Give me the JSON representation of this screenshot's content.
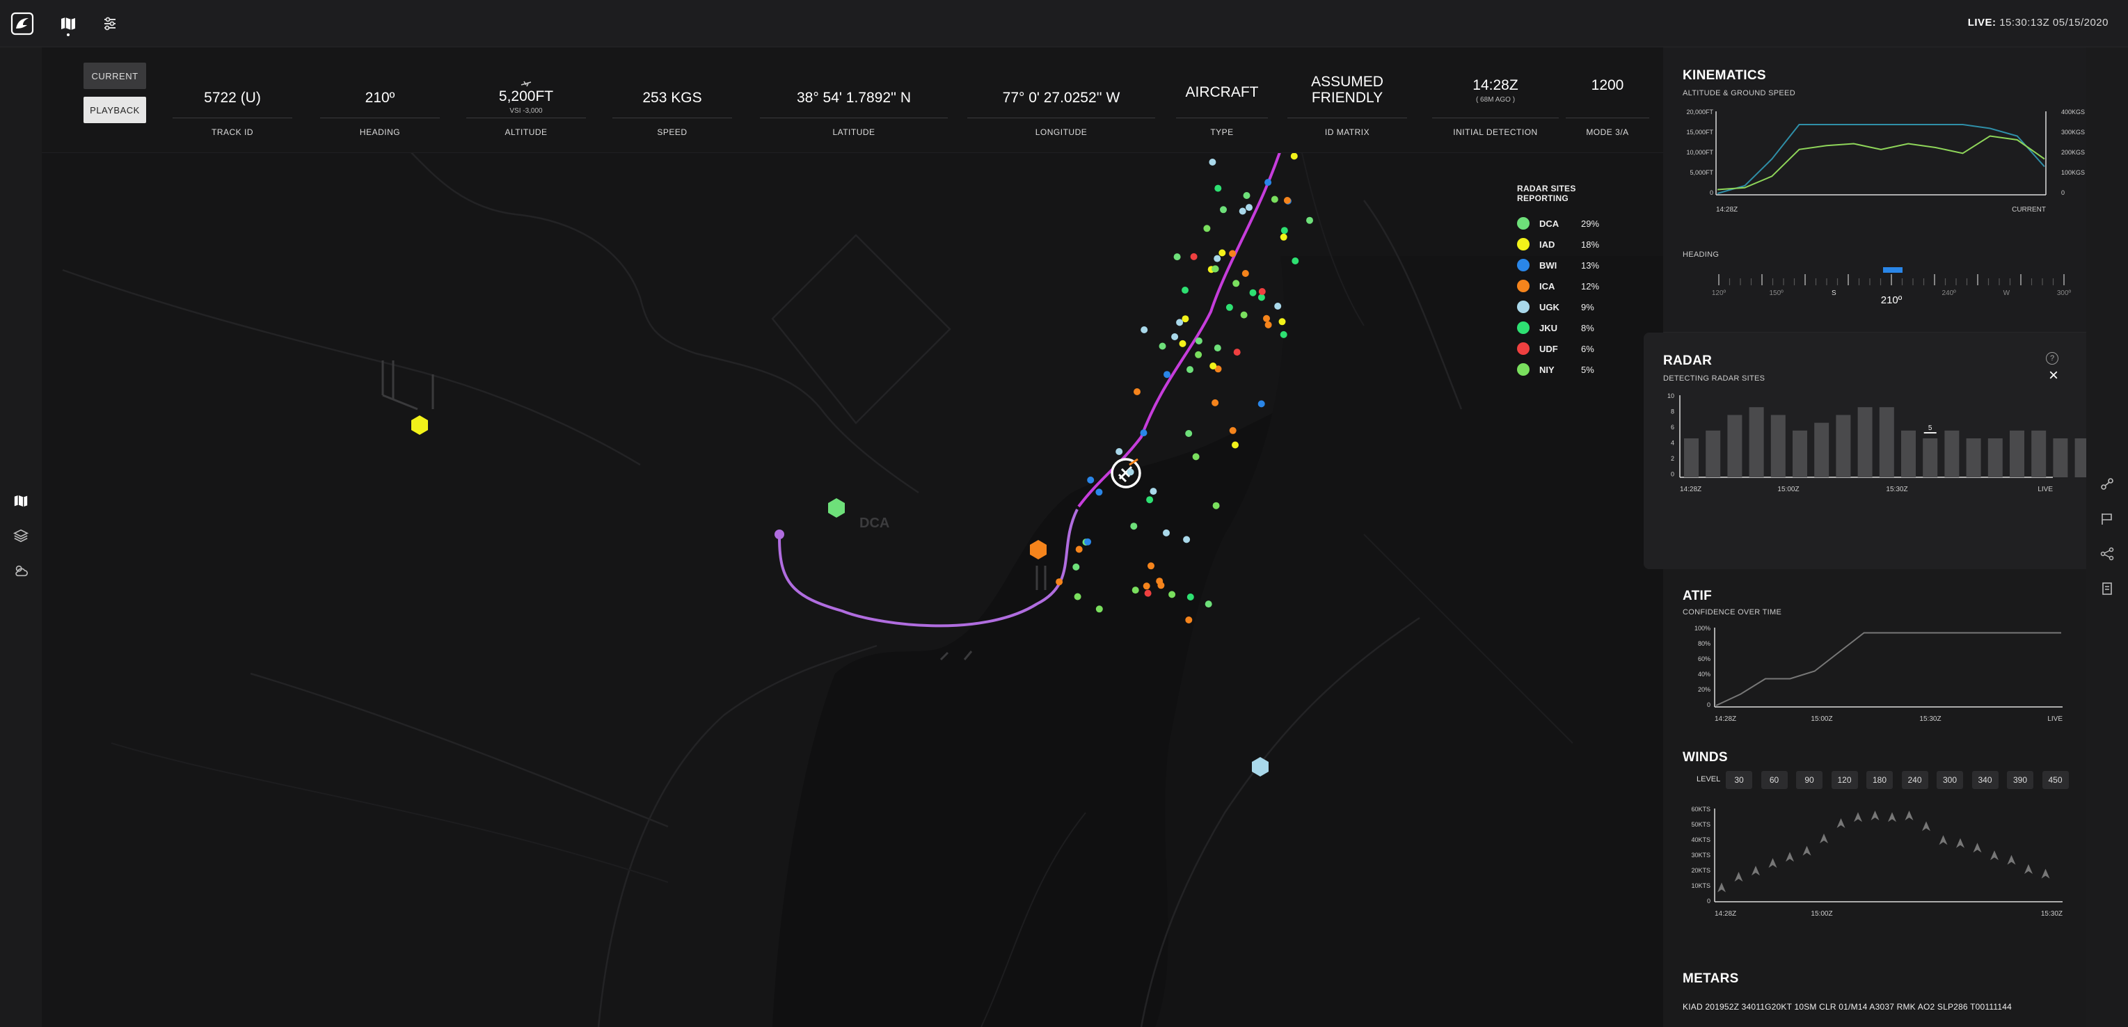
{
  "header": {
    "live_label": "LIVE:",
    "live_time": "15:30:13Z 05/15/2020"
  },
  "topbar_icons": [
    "app-logo-icon",
    "map-icon",
    "sliders-icon"
  ],
  "left_rail": [
    "map-icon",
    "layers-icon",
    "weather-icon"
  ],
  "right_rail": [
    "route-icon",
    "flag-icon",
    "network-icon",
    "document-icon"
  ],
  "mode": {
    "current": "CURRENT",
    "playback": "PLAYBACK"
  },
  "telemetry": {
    "track_id": {
      "value": "5722 (U)",
      "label": "TRACK ID"
    },
    "heading": {
      "value": "210º",
      "label": "HEADING"
    },
    "altitude": {
      "value": "5,200FT",
      "sub": "VSI -3,000",
      "label": "ALTITUDE"
    },
    "speed": {
      "value": "253 KGS",
      "label": "SPEED"
    },
    "latitude": {
      "value": "38° 54' 1.7892'' N",
      "label": "LATITUDE"
    },
    "longitude": {
      "value": "77° 0' 27.0252'' W",
      "label": "LONGITUDE"
    },
    "type": {
      "value": "AIRCRAFT",
      "label": "TYPE"
    },
    "id_matrix": {
      "value1": "ASSUMED",
      "value2": "FRIENDLY",
      "label": "ID MATRIX"
    },
    "initial_detection": {
      "value": "14:28Z",
      "sub": "( 68M AGO )",
      "label": "INITIAL DETECTION"
    },
    "mode_3a": {
      "value": "1200",
      "label": "MODE 3/A"
    }
  },
  "map": {
    "airport_label": "DCA"
  },
  "radar_sites": {
    "title": "RADAR SITES REPORTING",
    "sites": [
      {
        "name": "DCA",
        "pct": "29%",
        "color": "#6ee07a"
      },
      {
        "name": "IAD",
        "pct": "18%",
        "color": "#f2f21a"
      },
      {
        "name": "BWI",
        "pct": "13%",
        "color": "#2a86e8"
      },
      {
        "name": "ICA",
        "pct": "12%",
        "color": "#f5841c"
      },
      {
        "name": "UGK",
        "pct": "9%",
        "color": "#a9d8ea"
      },
      {
        "name": "JKU",
        "pct": "8%",
        "color": "#2ee072"
      },
      {
        "name": "UDF",
        "pct": "6%",
        "color": "#ef4040"
      },
      {
        "name": "NIY",
        "pct": "5%",
        "color": "#7adf5e"
      }
    ]
  },
  "kinematics": {
    "title": "KINEMATICS",
    "subtitle": "ALTITUDE & GROUND SPEED",
    "y_left": [
      "20,000FT",
      "15,000FT",
      "10,000FT",
      "5,000FT",
      "0"
    ],
    "y_right": [
      "400KGS",
      "300KGS",
      "200KGS",
      "100KGS",
      "0"
    ],
    "x_start": "14:28Z",
    "x_end": "CURRENT",
    "heading_label": "HEADING",
    "heading_ticks": [
      "120º",
      "150º",
      "S",
      "210º",
      "240º",
      "W",
      "300º"
    ]
  },
  "radar": {
    "title": "RADAR",
    "subtitle": "DETECTING RADAR SITES",
    "help": "?",
    "close": "×",
    "y_ticks": [
      "10",
      "8",
      "6",
      "4",
      "2",
      "0"
    ],
    "x_ticks": [
      "14:28Z",
      "15:00Z",
      "15:30Z",
      "LIVE"
    ],
    "marker_label": "5"
  },
  "atif": {
    "title": "ATIF",
    "subtitle": "CONFIDENCE OVER TIME",
    "y_ticks": [
      "100%",
      "80%",
      "60%",
      "40%",
      "20%",
      "0"
    ],
    "x_ticks": [
      "14:28Z",
      "15:00Z",
      "15:30Z",
      "LIVE"
    ]
  },
  "winds": {
    "title": "WINDS",
    "level_label": "LEVEL",
    "levels": [
      "30",
      "60",
      "90",
      "120",
      "180",
      "240",
      "300",
      "340",
      "390",
      "450"
    ],
    "y_ticks": [
      "60KTS",
      "50KTS",
      "40KTS",
      "30KTS",
      "20KTS",
      "10KTS",
      "0"
    ],
    "x_ticks": [
      "14:28Z",
      "15:00Z",
      "15:30Z"
    ]
  },
  "metars": {
    "title": "METARS",
    "text": "KIAD 201952Z 34011G20KT 10SM CLR 01/M14 A3037 RMK AO2 SLP286 T00111144"
  },
  "chart_data": [
    {
      "type": "line",
      "title": "KINEMATICS",
      "subtitle": "ALTITUDE & GROUND SPEED",
      "x": [
        "14:28Z",
        "CURRENT"
      ],
      "series": [
        {
          "values": [
            0,
            2000,
            9000,
            18000,
            18000,
            18000,
            18000,
            18000,
            18000,
            18000,
            17000,
            15000,
            7000
          ],
          "color": "#2f8fa8"
        },
        {
          "values": [
            20,
            30,
            90,
            230,
            250,
            260,
            230,
            260,
            240,
            210,
            300,
            280,
            180
          ],
          "color": "#8fd65a"
        }
      ],
      "ylim_left": [
        0,
        20000
      ],
      "ylim_right": [
        0,
        400
      ]
    },
    {
      "type": "bar",
      "title": "RADAR",
      "subtitle": "DETECTING RADAR SITES",
      "values": [
        5,
        6,
        8,
        9,
        8,
        6,
        7,
        8,
        9,
        9,
        6,
        5,
        6,
        5,
        5,
        6,
        6,
        5,
        5
      ],
      "ylim": [
        0,
        10
      ]
    },
    {
      "type": "line",
      "title": "ATIF",
      "subtitle": "CONFIDENCE OVER TIME",
      "values": [
        0,
        15,
        35,
        35,
        45,
        70,
        95,
        95,
        95,
        95,
        95,
        95,
        95,
        95,
        95
      ],
      "ylim": [
        0,
        100
      ]
    },
    {
      "type": "scatter",
      "title": "WINDS",
      "values": [
        8,
        15,
        19,
        24,
        28,
        32,
        40,
        50,
        54,
        55,
        54,
        55,
        48,
        39,
        37,
        34,
        29,
        26,
        20,
        17
      ],
      "ylim": [
        0,
        60
      ]
    }
  ]
}
